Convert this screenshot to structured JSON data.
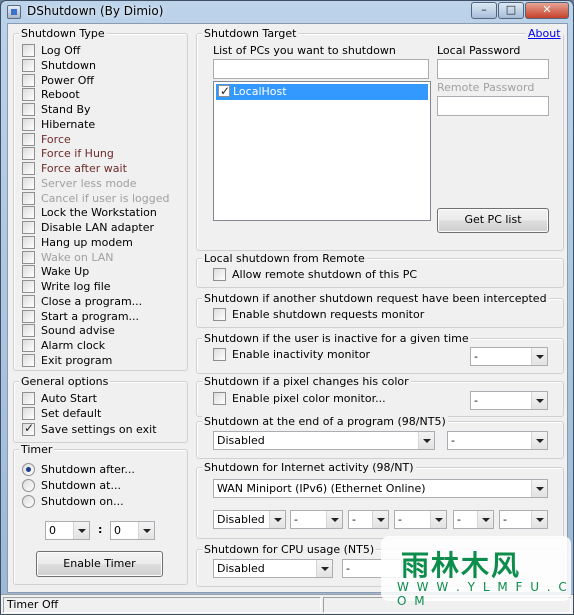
{
  "window": {
    "title": "DShutdown (By Dimio)"
  },
  "shutdown_type": {
    "legend": "Shutdown Type",
    "items": [
      {
        "label": "Log Off",
        "checked": false,
        "state": "normal"
      },
      {
        "label": "Shutdown",
        "checked": false,
        "state": "normal"
      },
      {
        "label": "Power Off",
        "checked": false,
        "state": "normal"
      },
      {
        "label": "Reboot",
        "checked": false,
        "state": "normal"
      },
      {
        "label": "Stand By",
        "checked": false,
        "state": "normal"
      },
      {
        "label": "Hibernate",
        "checked": false,
        "state": "normal"
      },
      {
        "label": "Force",
        "checked": false,
        "state": "red"
      },
      {
        "label": "Force if Hung",
        "checked": false,
        "state": "red"
      },
      {
        "label": "Force after wait",
        "checked": false,
        "state": "red"
      },
      {
        "label": "Server less mode",
        "checked": false,
        "state": "disabled"
      },
      {
        "label": "Cancel if user is logged",
        "checked": false,
        "state": "disabled"
      },
      {
        "label": "Lock the Workstation",
        "checked": false,
        "state": "normal"
      },
      {
        "label": "Disable LAN adapter",
        "checked": false,
        "state": "normal"
      },
      {
        "label": "Hang up modem",
        "checked": false,
        "state": "normal"
      },
      {
        "label": "Wake on LAN",
        "checked": false,
        "state": "disabled"
      },
      {
        "label": "Wake Up",
        "checked": false,
        "state": "normal"
      },
      {
        "label": "Write log file",
        "checked": false,
        "state": "normal"
      },
      {
        "label": "Close a program...",
        "checked": false,
        "state": "normal"
      },
      {
        "label": "Start a program...",
        "checked": false,
        "state": "normal"
      },
      {
        "label": "Sound advise",
        "checked": false,
        "state": "normal"
      },
      {
        "label": "Alarm clock",
        "checked": false,
        "state": "normal"
      },
      {
        "label": "Exit program",
        "checked": false,
        "state": "normal"
      }
    ]
  },
  "general_options": {
    "legend": "General options",
    "items": [
      {
        "label": "Auto Start",
        "checked": false
      },
      {
        "label": "Set default",
        "checked": false
      },
      {
        "label": "Save settings on exit",
        "checked": true
      }
    ]
  },
  "timer": {
    "legend": "Timer",
    "options": [
      {
        "label": "Shutdown after...",
        "selected": true
      },
      {
        "label": "Shutdown at...",
        "selected": false
      },
      {
        "label": "Shutdown on...",
        "selected": false
      }
    ],
    "hours": "0",
    "separator": ":",
    "minutes": "0",
    "enable_button": "Enable Timer"
  },
  "target": {
    "legend": "Shutdown Target",
    "about_link": "About",
    "list_label": "List of PCs you want to shutdown",
    "list_input": "",
    "pcs": [
      {
        "name": "LocalHost",
        "checked": true
      }
    ],
    "local_password_label": "Local Password",
    "remote_password_label": "Remote Password",
    "get_pc_list_button": "Get PC list"
  },
  "sections": {
    "remote": {
      "legend": "Local shutdown from Remote",
      "option": "Allow remote shutdown of this PC"
    },
    "intercept": {
      "legend": "Shutdown if another shutdown request have been intercepted",
      "option": "Enable shutdown requests monitor"
    },
    "inactive": {
      "legend": "Shutdown if the user is inactive for a given time",
      "option": "Enable inactivity monitor",
      "select": "-"
    },
    "pixel": {
      "legend": "Shutdown if a pixel changes his color",
      "option": "Enable pixel color monitor...",
      "select": "-"
    },
    "program_end": {
      "legend": "Shutdown at the end of a program (98/NT5)",
      "select1": "Disabled",
      "select2": "-"
    },
    "internet": {
      "legend": "Shutdown for Internet activity (98/NT)",
      "adapter": "WAN Miniport (IPv6) (Ethernet Online)",
      "mode": "Disabled",
      "fields": [
        "-",
        "-",
        "-",
        "-",
        "-"
      ]
    },
    "cpu": {
      "legend": "Shutdown for CPU usage (NT5)",
      "mode": "Disabled",
      "field": "-"
    }
  },
  "status_bar": {
    "text": "Timer Off"
  },
  "watermark": {
    "cn": "雨林木风",
    "url": "W W W . Y L M F U . C O M"
  }
}
